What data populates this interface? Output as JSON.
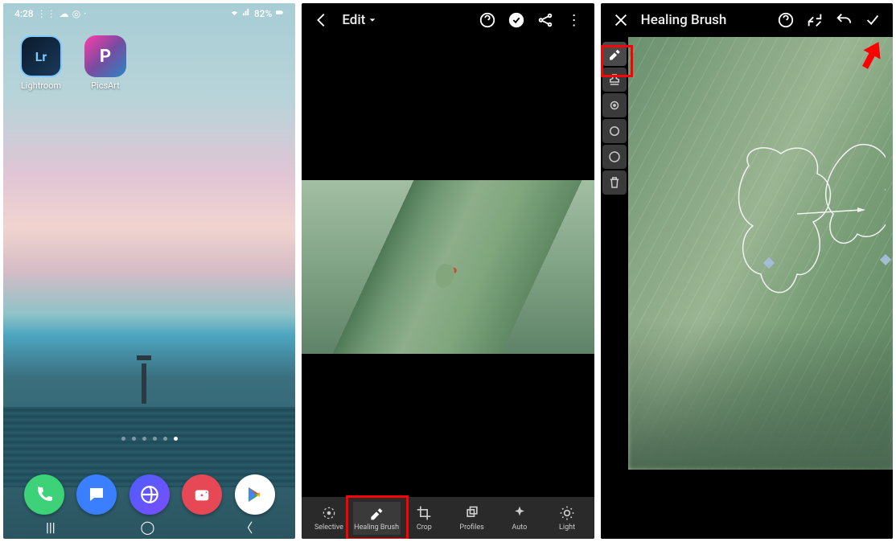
{
  "panel1": {
    "statusbar": {
      "time": "4:28",
      "battery": "82%"
    },
    "apps": [
      {
        "label": "Lightroom",
        "badge": "Lr"
      },
      {
        "label": "PicsArt",
        "badge": "P"
      }
    ],
    "dock": [
      "phone",
      "messages",
      "browser",
      "camera",
      "play"
    ]
  },
  "panel2": {
    "title": "Edit",
    "tools": [
      {
        "label": "Selective"
      },
      {
        "label": "Healing Brush",
        "selected": true
      },
      {
        "label": "Crop"
      },
      {
        "label": "Profiles"
      },
      {
        "label": "Auto"
      },
      {
        "label": "Light"
      }
    ]
  },
  "panel3": {
    "title": "Healing Brush",
    "side_tools": [
      "heal",
      "stamp",
      "feather",
      "opacity",
      "size",
      "delete"
    ]
  }
}
